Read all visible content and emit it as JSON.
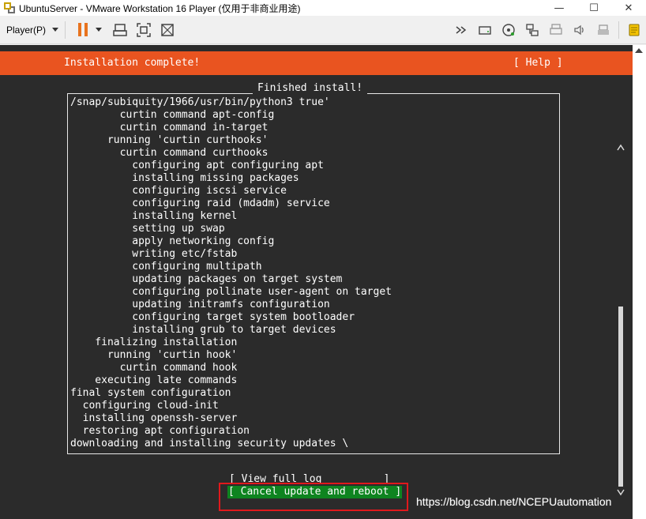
{
  "window": {
    "title": "UbuntuServer - VMware Workstation 16 Player (仅用于非商业用途)",
    "minimize": "—",
    "maximize": "☐",
    "close": "✕"
  },
  "toolbar": {
    "player_menu": "Player(P)",
    "accent": "#e8731e"
  },
  "installer": {
    "header_title": "Installation complete!",
    "help": "[ Help ]",
    "panel_title": "Finished install!",
    "log_lines": [
      "/snap/subiquity/1966/usr/bin/python3 true'",
      "        curtin command apt-config",
      "        curtin command in-target",
      "      running 'curtin curthooks'",
      "        curtin command curthooks",
      "          configuring apt configuring apt",
      "          installing missing packages",
      "          configuring iscsi service",
      "          configuring raid (mdadm) service",
      "          installing kernel",
      "          setting up swap",
      "          apply networking config",
      "          writing etc/fstab",
      "          configuring multipath",
      "          updating packages on target system",
      "          configuring pollinate user-agent on target",
      "          updating initramfs configuration",
      "          configuring target system bootloader",
      "          installing grub to target devices",
      "    finalizing installation",
      "      running 'curtin hook'",
      "        curtin command hook",
      "    executing late commands",
      "final system configuration",
      "  configuring cloud-init",
      "  installing openssh-server",
      "  restoring apt configuration",
      "downloading and installing security updates \\"
    ],
    "view_full_log": "[ View full log          ]",
    "cancel_reboot": "[ Cancel update and reboot ]",
    "header_color": "#e95420",
    "button_color": "#0e8420"
  },
  "watermark": "https://blog.csdn.net/NCEPUautomation"
}
